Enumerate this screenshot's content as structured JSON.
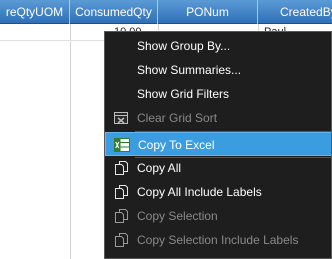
{
  "grid": {
    "columns": [
      {
        "label": "reQtyUOM"
      },
      {
        "label": "ConsumedQty"
      },
      {
        "label": "PONum"
      },
      {
        "label": "CreatedBy"
      }
    ],
    "row1": {
      "consumed_qty": "10.00",
      "created_by": "Paul"
    }
  },
  "context_menu": {
    "items": [
      {
        "label": "Show Group By...",
        "enabled": true
      },
      {
        "label": "Show Summaries...",
        "enabled": true
      },
      {
        "label": "Show Grid Filters",
        "enabled": true
      },
      {
        "label": "Clear Grid Sort",
        "enabled": false,
        "icon": "clear-sort-icon"
      },
      {
        "label": "Copy To Excel",
        "enabled": true,
        "selected": true,
        "icon": "excel-icon"
      },
      {
        "label": "Copy All",
        "enabled": true,
        "icon": "copy-icon"
      },
      {
        "label": "Copy All Include Labels",
        "enabled": true,
        "icon": "copy-icon"
      },
      {
        "label": "Copy Selection",
        "enabled": false,
        "icon": "copy-icon"
      },
      {
        "label": "Copy Selection Include Labels",
        "enabled": false,
        "icon": "copy-icon"
      }
    ]
  },
  "colors": {
    "header_top": "#5b9bd5",
    "header_bottom": "#2f6fb8",
    "menu_bg": "#1e1e1e",
    "menu_highlight": "#3b9ddf",
    "disabled_text": "#8a8a8a"
  }
}
